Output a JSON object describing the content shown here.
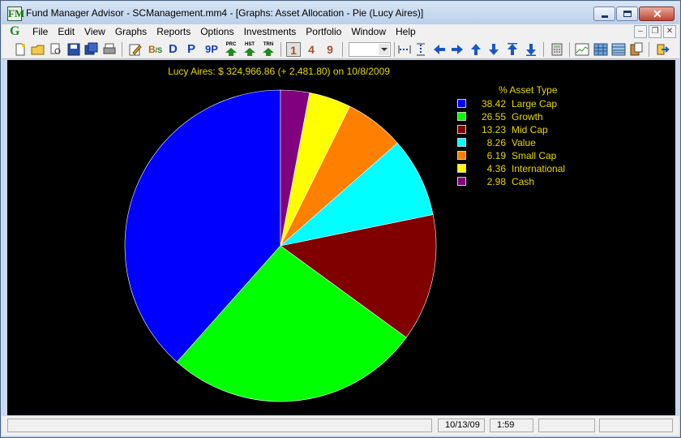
{
  "window": {
    "title": "Fund Manager Advisor - SCManagement.mm4 - [Graphs: Asset Allocation - Pie (Lucy Aires)]",
    "app_icon_text": "FM"
  },
  "menubar": {
    "logo": "G",
    "items": [
      "File",
      "Edit",
      "View",
      "Graphs",
      "Reports",
      "Options",
      "Investments",
      "Portfolio",
      "Window",
      "Help"
    ]
  },
  "toolbar": {
    "letters": [
      "D",
      "P",
      "9P"
    ],
    "mini": [
      "PRC",
      "HST",
      "TRN"
    ],
    "numbers": [
      "1",
      "4",
      "9"
    ],
    "combo_value": ""
  },
  "graph": {
    "header": "Lucy Aires: $ 324,966.86 (+ 2,481.80) on 10/8/2009",
    "legend_header": "%  Asset Type"
  },
  "chart_data": {
    "type": "pie",
    "title": "Lucy Aires: $ 324,966.86 (+ 2,481.80) on 10/8/2009",
    "categories": [
      "Large Cap",
      "Growth",
      "Mid Cap",
      "Value",
      "Small Cap",
      "International",
      "Cash"
    ],
    "values": [
      38.42,
      26.55,
      13.23,
      8.26,
      6.19,
      4.36,
      2.98
    ],
    "labels": [
      "38.42",
      "26.55",
      "13.23",
      "8.26",
      "6.19",
      "4.36",
      "2.98"
    ],
    "colors": [
      "#0000ff",
      "#00ff00",
      "#800000",
      "#00ffff",
      "#ff8000",
      "#ffff00",
      "#800080"
    ],
    "legend_placement": "right",
    "background": "#000000"
  },
  "statusbar": {
    "date": "10/13/09",
    "time": "1:59"
  }
}
